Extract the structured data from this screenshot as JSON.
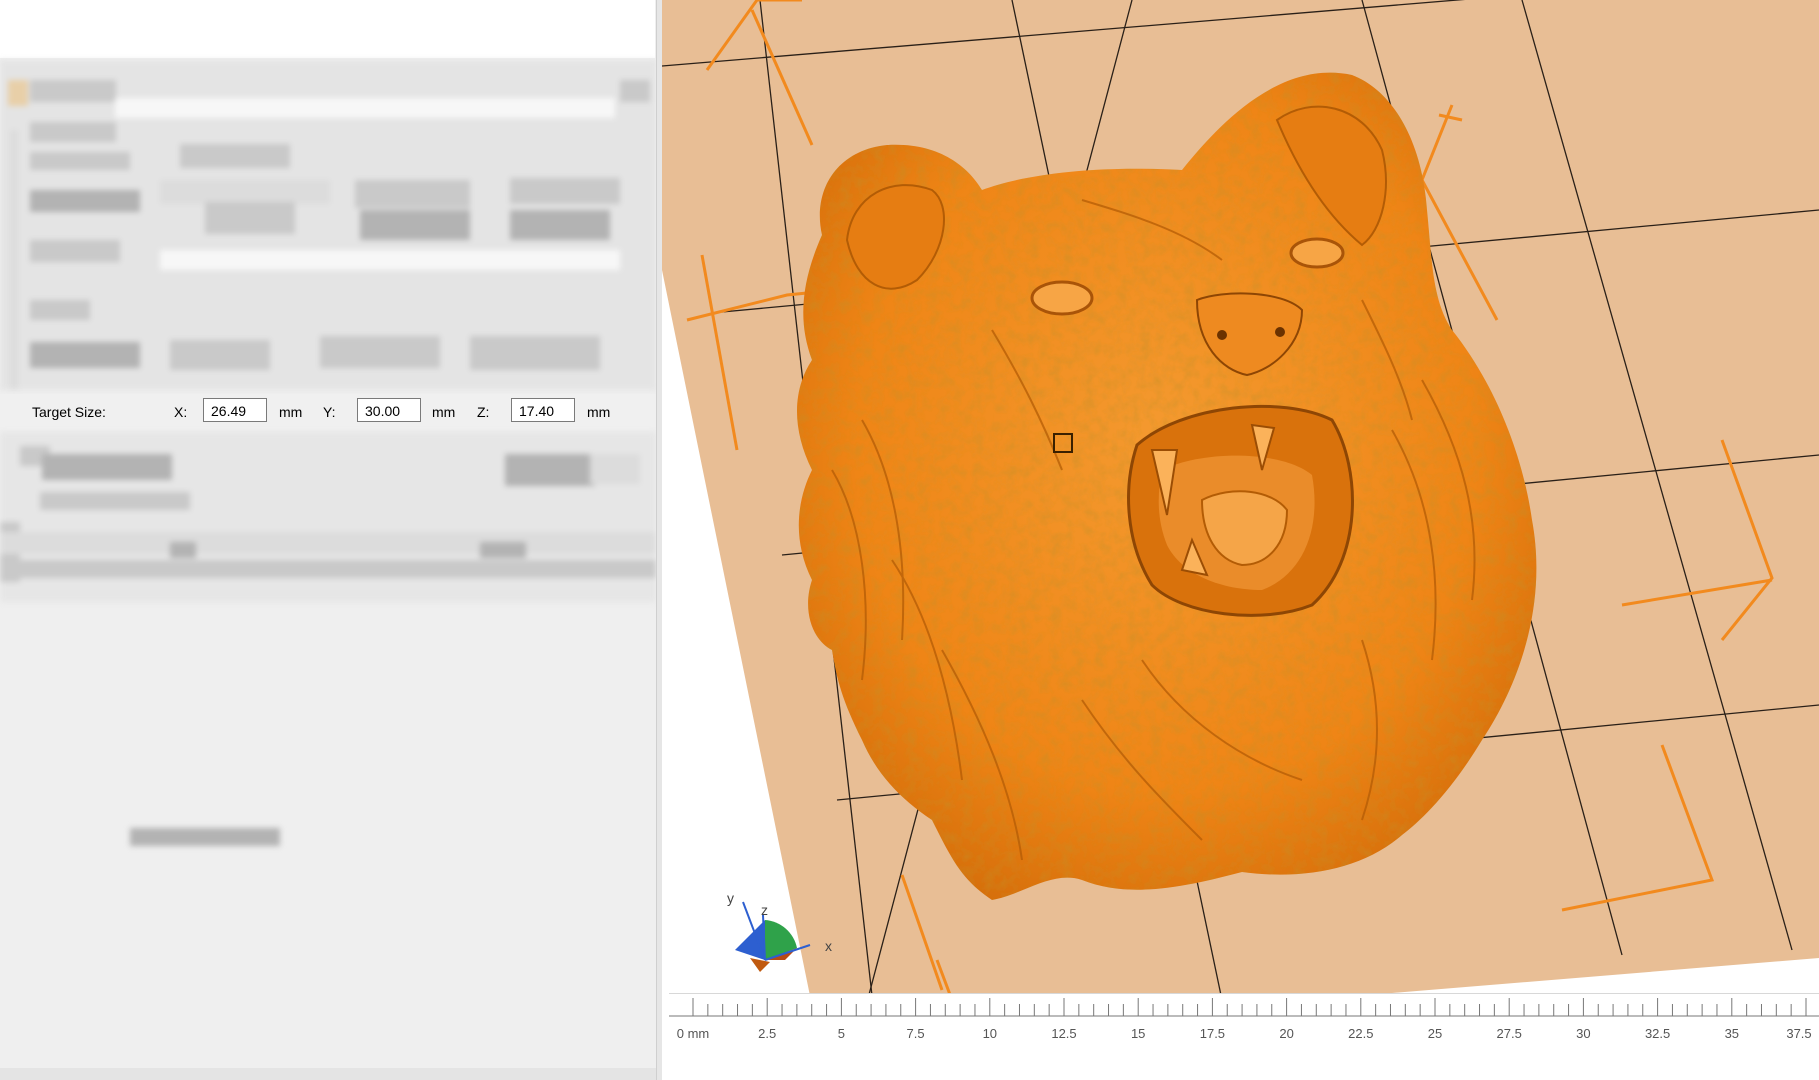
{
  "panel": {
    "target_size": {
      "label": "Target Size:",
      "x_label": "X:",
      "x_value": "26.49",
      "y_label": "Y:",
      "y_value": "30.00",
      "z_label": "Z:",
      "z_value": "17.40",
      "unit": "mm"
    }
  },
  "viewport": {
    "axes": {
      "x": "x",
      "y": "y",
      "z": "z"
    },
    "model_color": "#f28a1e",
    "bed_color": "#e9bd93",
    "ruler": {
      "ticks": [
        {
          "label": "0 mm"
        },
        {
          "label": "2.5"
        },
        {
          "label": "5"
        },
        {
          "label": "7.5"
        },
        {
          "label": "10"
        },
        {
          "label": "12.5"
        },
        {
          "label": "15"
        },
        {
          "label": "17.5"
        },
        {
          "label": "20"
        },
        {
          "label": "22.5"
        },
        {
          "label": "25"
        },
        {
          "label": "27.5"
        },
        {
          "label": "30"
        },
        {
          "label": "32.5"
        },
        {
          "label": "35"
        },
        {
          "label": "37.5"
        }
      ]
    }
  }
}
